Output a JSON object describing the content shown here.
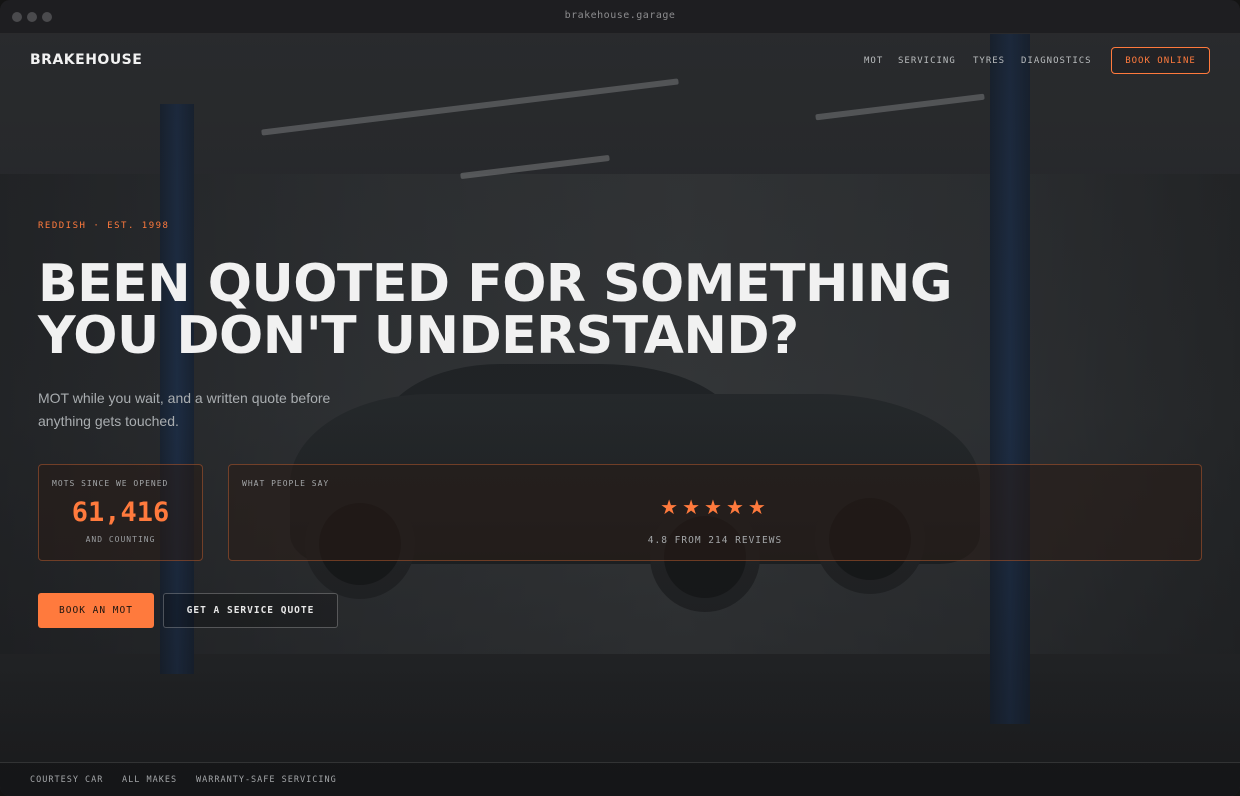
{
  "browser": {
    "url": "brakehouse.garage"
  },
  "header": {
    "brand": "BRAKEHOUSE",
    "nav": [
      "MOT",
      "SERVICING",
      "TYRES",
      "DIAGNOSTICS"
    ],
    "cta": "BOOK ONLINE"
  },
  "hero": {
    "eyebrow": "REDDISH · EST. 1998",
    "headline_line1": "BEEN QUOTED FOR SOMETHING",
    "headline_line2": "YOU DON'T UNDERSTAND?",
    "subtext": "MOT while you wait, and a written quote before anything gets touched."
  },
  "stats": {
    "mots": {
      "label": "MOTS SINCE WE OPENED",
      "value": "61,416",
      "caption": "AND COUNTING"
    },
    "reviews": {
      "label": "WHAT PEOPLE SAY",
      "stars": "★★★★★",
      "summary": "4.8 FROM 214 REVIEWS"
    }
  },
  "actions": {
    "primary": "BOOK AN MOT",
    "secondary": "GET A SERVICE QUOTE"
  },
  "footer": {
    "features": [
      "COURTESY CAR",
      "ALL MAKES",
      "WARRANTY-SAFE SERVICING"
    ]
  },
  "colors": {
    "accent": "#ff7a3d",
    "background": "#1d1d1f"
  }
}
